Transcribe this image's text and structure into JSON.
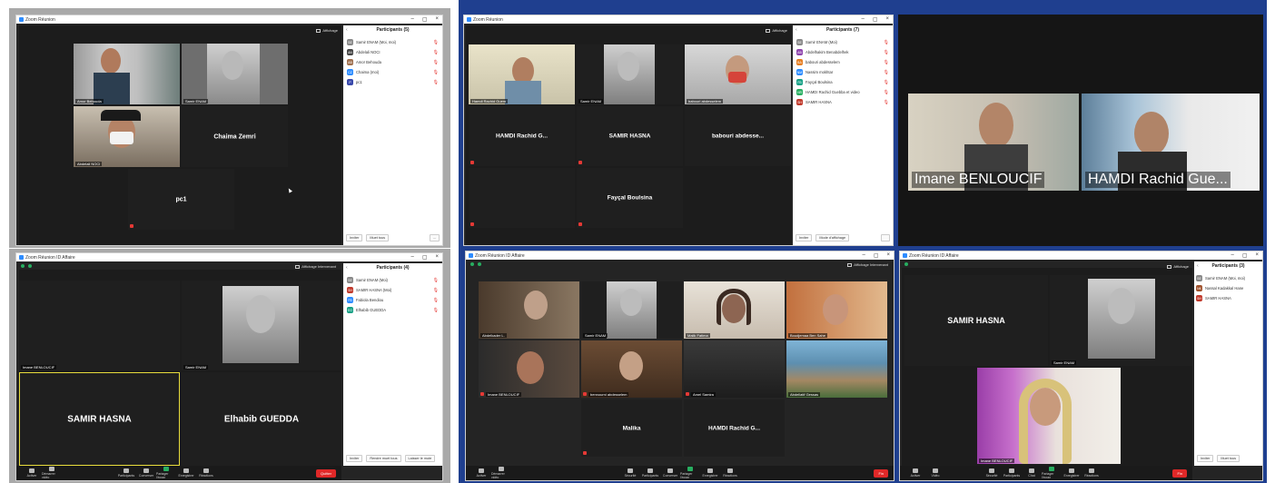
{
  "colors": {
    "zoom_blue": "#2d8cff",
    "active_speaker": "#e8dd3c",
    "muted_red": "#e53935",
    "share_green": "#27ae60",
    "end_red": "#e02828",
    "frame_blue": "#1f3f8f"
  },
  "p1": {
    "window_title": "Zoom Réunion",
    "view_label": "Affichage",
    "tiles": {
      "t1": "Amor Behouda",
      "t2": "Samir ENAM",
      "t3": "Abdelali NOCI",
      "t4_big": "Chaima Zemri",
      "t5_big": "pc1"
    },
    "participants_title": "Participants (5)",
    "participants": [
      {
        "initial": "SE",
        "name": "Samir ENAM (Moi, moi)"
      },
      {
        "initial": "AN",
        "name": "Abdelali NOCI"
      },
      {
        "initial": "AB",
        "name": "Amor Behouda"
      },
      {
        "initial": "CZ",
        "name": "Chaima (moi)"
      },
      {
        "initial": "P",
        "name": "pc1"
      }
    ],
    "buttons": [
      "Inviter",
      "Muet tous",
      "..."
    ]
  },
  "p2": {
    "window_title": "Zoom Réunion",
    "view_label": "Affichage",
    "tiles": {
      "t1": "Hamdi Rachid Guem",
      "t2": "Samir ENAM",
      "t3": "babouri abdesselem",
      "t4_big": "HAMDI Rachid G...",
      "t5_big": "SAMIR HASNA",
      "t6_big": "babouri abdesse...",
      "t7_big": "Fayçal Boulsina"
    },
    "participants_title": "Participants (7)",
    "participants": [
      {
        "initial": "SE",
        "name": "Samir ENAM (Moi)"
      },
      {
        "initial": "AB",
        "name": "Abdelhakim Benabdelhek"
      },
      {
        "initial": "BA",
        "name": "babouri abdesselem"
      },
      {
        "initial": "NM",
        "name": "Nassim mokhtar"
      },
      {
        "initial": "FB",
        "name": "Fayçal Boulsina"
      },
      {
        "initial": "HR",
        "name": "HAMDI Rachid Guebba et video"
      },
      {
        "initial": "SH",
        "name": "SAMIR HASNA"
      }
    ],
    "buttons": [
      "Inviter",
      "Mode d'affichage",
      ""
    ]
  },
  "p3": {
    "tiles": {
      "t1": "Imane BENLOUCIF",
      "t2": "HAMDI Rachid Gue..."
    }
  },
  "p4": {
    "window_title": "Zoom Réunion ID Affaire",
    "view_label": "Affichage Intervenant",
    "tiles": {
      "t1": "Imane BENLOUCIF",
      "t2": "Samir ENAM",
      "t3_big": "SAMIR HASNA",
      "t4_big": "Elhabib GUEDDA"
    },
    "participants_title": "Participants (4)",
    "participants": [
      {
        "initial": "SE",
        "name": "Samir ENAM (Moi)"
      },
      {
        "initial": "SH",
        "name": "SAMIR HASNA (Moi)"
      },
      {
        "initial": "FB",
        "name": "Fabiola Bendiou"
      },
      {
        "initial": "EG",
        "name": "Elhabib GUEDDA"
      }
    ],
    "buttons": [
      "Inviter",
      "Rendre muet tous",
      "Laisser le mute"
    ],
    "toolbar": [
      "Activer",
      "Démarrer vidéo",
      "Participants",
      "Converser",
      "Partager l'écran",
      "Enregistrer",
      "Réactions"
    ],
    "end_label": "Quitter"
  },
  "p5": {
    "window_title": "Zoom Réunion ID Affaire",
    "view_label": "Affichage Intervenant",
    "tiles": {
      "t1": "Abdelkader L.",
      "t2": "Samir ENAM",
      "t3": "Malik Fatima",
      "t4": "Boudjemaa Ben Sahe",
      "t5": "Imane BENLOUCIF",
      "t6": "bennourni abdesselem",
      "t7": "Amel Samira",
      "t8": "Abdellatif Gessas",
      "t9_big": "Malika",
      "t10_big": "HAMDI Rachid G..."
    },
    "toolbar": [
      "Activer",
      "Démarrer vidéo",
      "Sécurité",
      "Participants",
      "Converser",
      "Partager l'écran",
      "Enregistrer",
      "Réactions"
    ],
    "end_label": "Fin"
  },
  "p6": {
    "window_title": "Zoom Réunion ID Affaire",
    "view_label": "Affichage",
    "tiles": {
      "t1_big": "SAMIR HASNA",
      "t2": "Samir ENAM",
      "t3": "Imane BENLOUCIF"
    },
    "participants_title": "Participants (3)",
    "participants": [
      {
        "initial": "SE",
        "name": "Samir ENAM (Moi, moi)"
      },
      {
        "initial": "NK",
        "name": "Nassal Kadakkal Hane"
      },
      {
        "initial": "SH",
        "name": "SAMIR HASNA"
      }
    ],
    "buttons": [
      "Inviter",
      "Muet tous"
    ],
    "toolbar": [
      "Activer",
      "Vidéo",
      "Sécurité",
      "Participants",
      "Chat",
      "Partager l'écran",
      "Enregistrer",
      "Réactions"
    ],
    "end_label": "Fin"
  }
}
